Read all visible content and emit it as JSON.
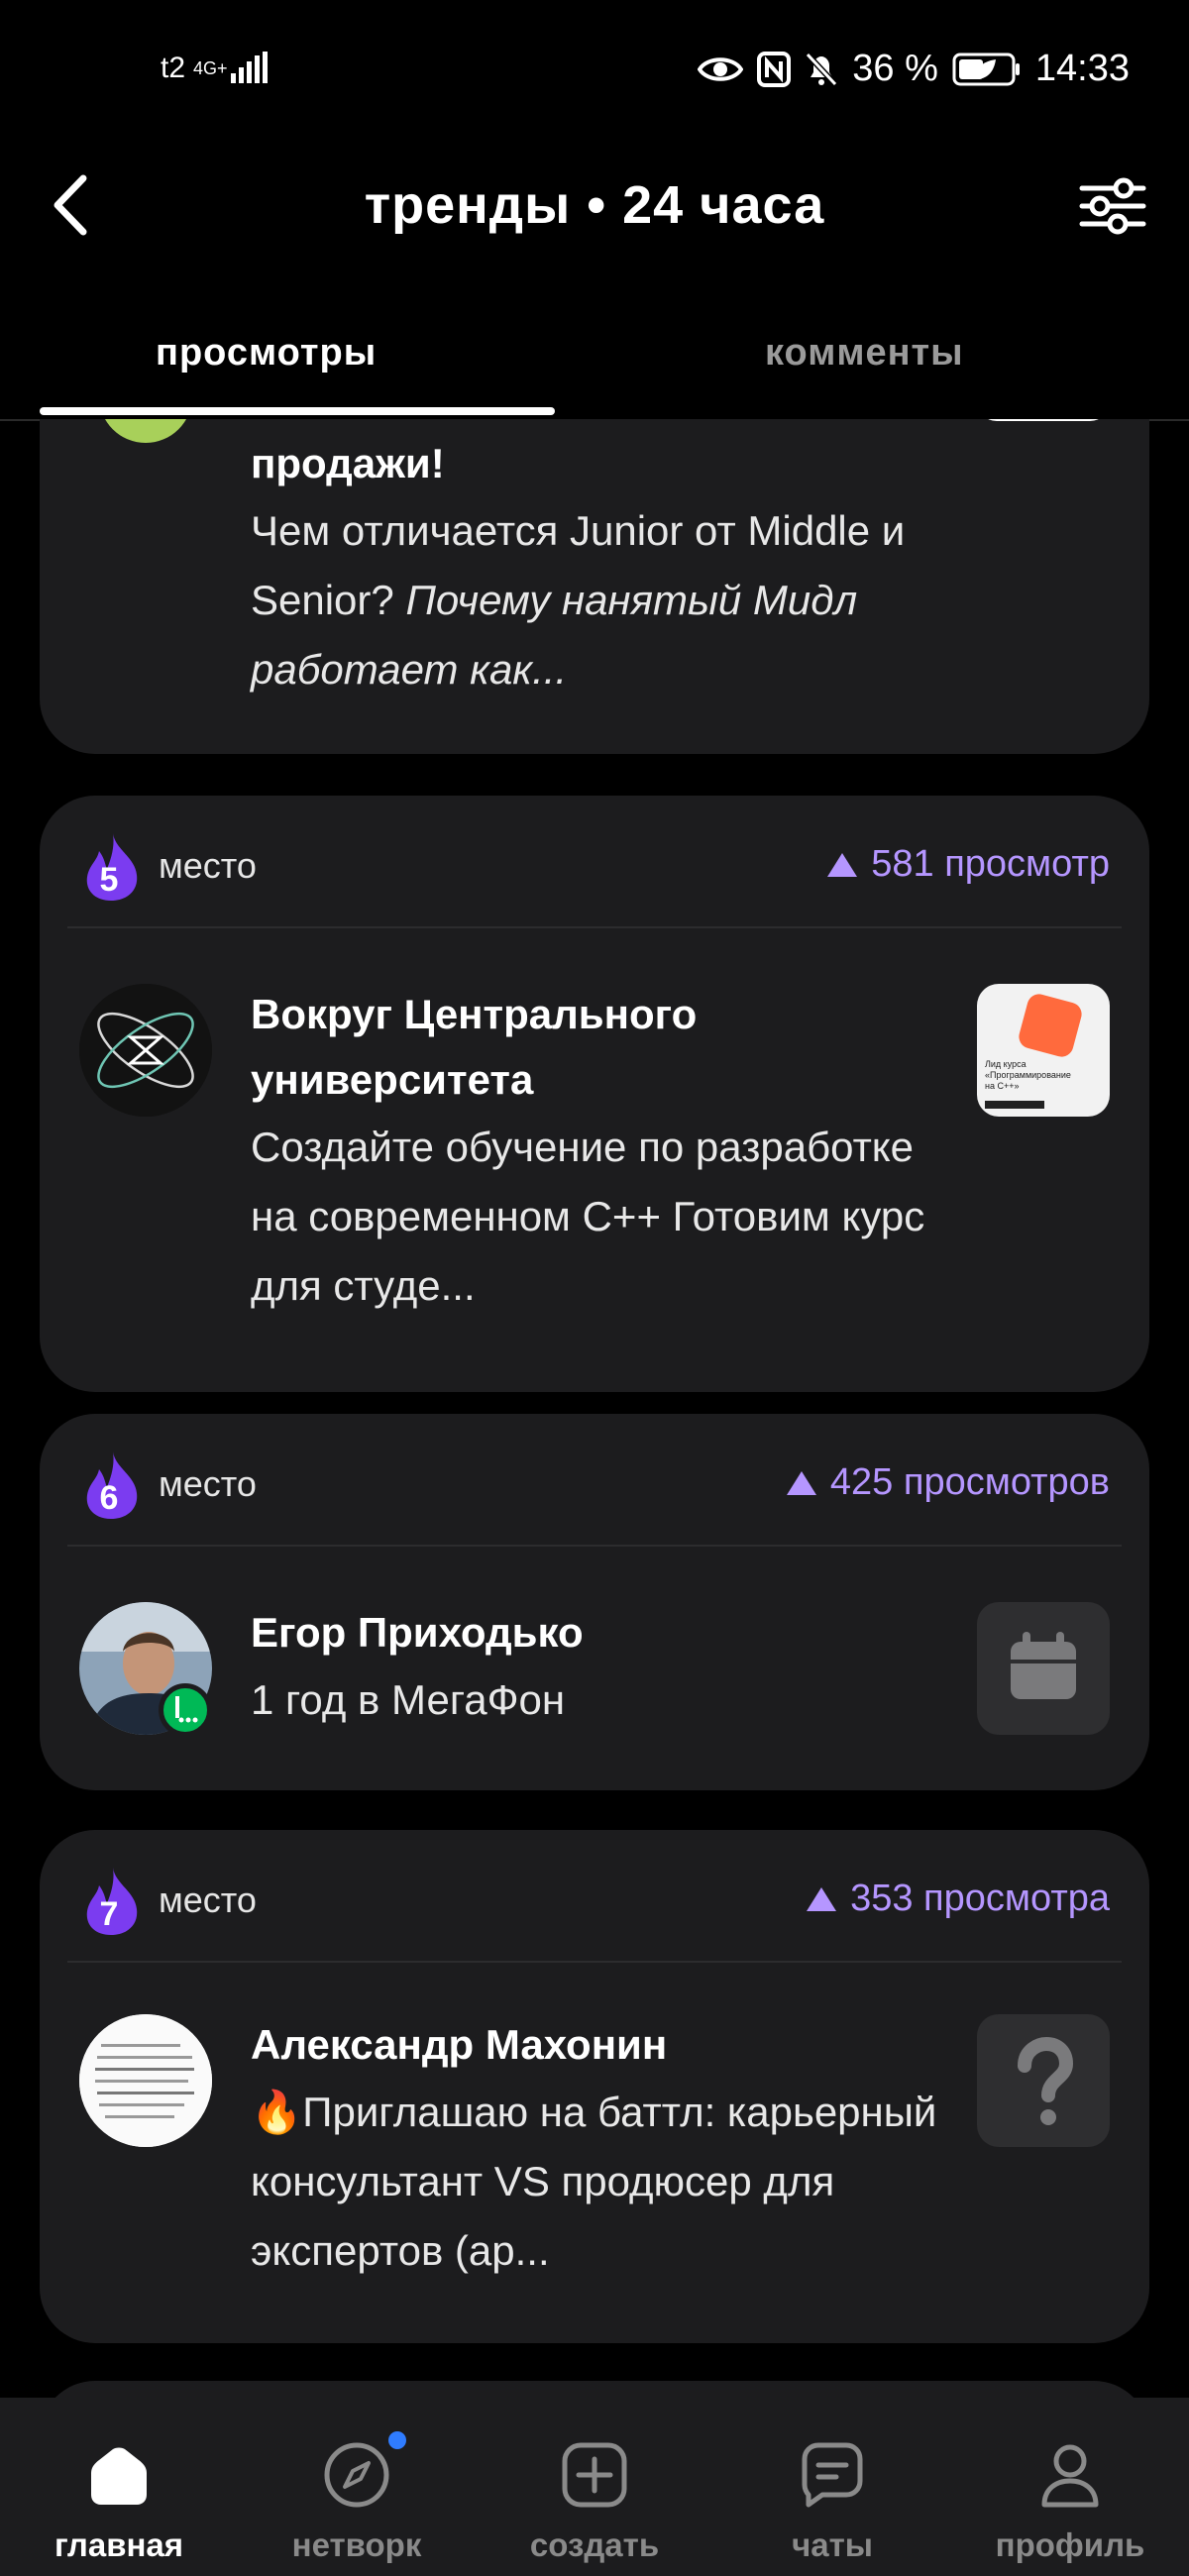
{
  "status_bar": {
    "carrier": "t2",
    "network": "4G+",
    "battery": "36 %",
    "time": "14:33",
    "icons": [
      "eye-icon",
      "nfc-icon",
      "bell-off-icon",
      "battery-icon"
    ]
  },
  "header": {
    "title": "тренды • 24 часа",
    "back_icon": "chevron-left-icon",
    "filter_icon": "sliders-icon"
  },
  "tabs": [
    {
      "label": "просмотры",
      "active": true
    },
    {
      "label": "комменты",
      "active": false
    }
  ],
  "cards": [
    {
      "title_partial": "продажи!",
      "desc_plain": "Чем отличается Junior от Middle и Senior?",
      "desc_italic": "Почему нанятый Мидл работает как..."
    },
    {
      "rank": "5",
      "place_label": "место",
      "views": "581 просмотр",
      "name": "Вокруг Центрального университета",
      "desc": "Создайте обучение по разработке на современном С++ Готовим курс для студе...",
      "thumb_text": "Лид курса «Программирование на С++»"
    },
    {
      "rank": "6",
      "place_label": "место",
      "views": "425 просмотров",
      "name": "Егор Приходько",
      "desc": "1 год в МегаФон",
      "thumb_icon": "calendar-icon"
    },
    {
      "rank": "7",
      "place_label": "место",
      "views": "353 просмотра",
      "name": "Александр Махонин",
      "desc": "🔥Приглашаю на баттл: карьерный консультант VS продюсер для экспертов (ар...",
      "thumb_icon": "question-icon"
    }
  ],
  "bottom_nav": [
    {
      "label": "главная",
      "icon": "home-icon",
      "active": true
    },
    {
      "label": "нетворк",
      "icon": "compass-icon",
      "active": false,
      "badge": true
    },
    {
      "label": "создать",
      "icon": "plus-square-icon",
      "active": false
    },
    {
      "label": "чаты",
      "icon": "chat-icon",
      "active": false
    },
    {
      "label": "профиль",
      "icon": "profile-icon",
      "active": false
    }
  ],
  "colors": {
    "accent": "#b596ff",
    "flame": "#7b3cf0",
    "card_bg": "#1c1c1e",
    "badge": "#2f7cff"
  }
}
